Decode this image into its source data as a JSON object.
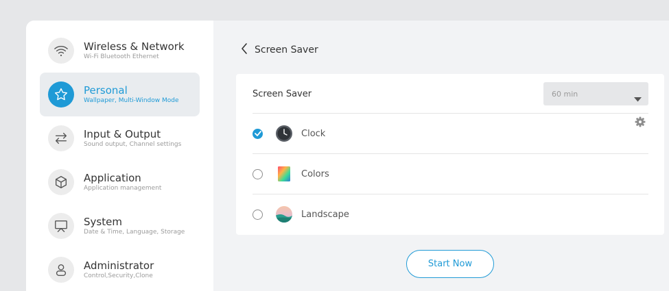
{
  "sidebar": {
    "items": [
      {
        "title": "Wireless & Network",
        "subtitle": "Wi-Fi Bluetooth Ethernet",
        "icon": "wifi-icon",
        "active": false
      },
      {
        "title": "Personal",
        "subtitle": "Wallpaper, Multi-Window Mode",
        "icon": "star-icon",
        "active": true
      },
      {
        "title": "Input & Output",
        "subtitle": "Sound output, Channel settings",
        "icon": "swap-arrows-icon",
        "active": false
      },
      {
        "title": "Application",
        "subtitle": "Application management",
        "icon": "cube-icon",
        "active": false
      },
      {
        "title": "System",
        "subtitle": "Date & Time, Language, Storage",
        "icon": "presentation-screen-icon",
        "active": false
      },
      {
        "title": "Administrator",
        "subtitle": "Control,Security,Clone",
        "icon": "user-icon",
        "active": false
      }
    ]
  },
  "header": {
    "title": "Screen Saver",
    "back_icon": "chevron-left-icon"
  },
  "card": {
    "setting_label": "Screen Saver",
    "duration": {
      "value": "60 min",
      "icon": "caret-down-icon"
    },
    "options": [
      {
        "label": "Clock",
        "selected": true,
        "icon": "clock-icon",
        "has_settings": true
      },
      {
        "label": "Colors",
        "selected": false,
        "icon": "colors-gradient-icon",
        "has_settings": false
      },
      {
        "label": "Landscape",
        "selected": false,
        "icon": "landscape-icon",
        "has_settings": false
      }
    ]
  },
  "start_button": {
    "label": "Start Now"
  },
  "colors": {
    "accent": "#1f9ad6",
    "background": "#e6e7e9",
    "content_bg": "#f2f3f5"
  }
}
